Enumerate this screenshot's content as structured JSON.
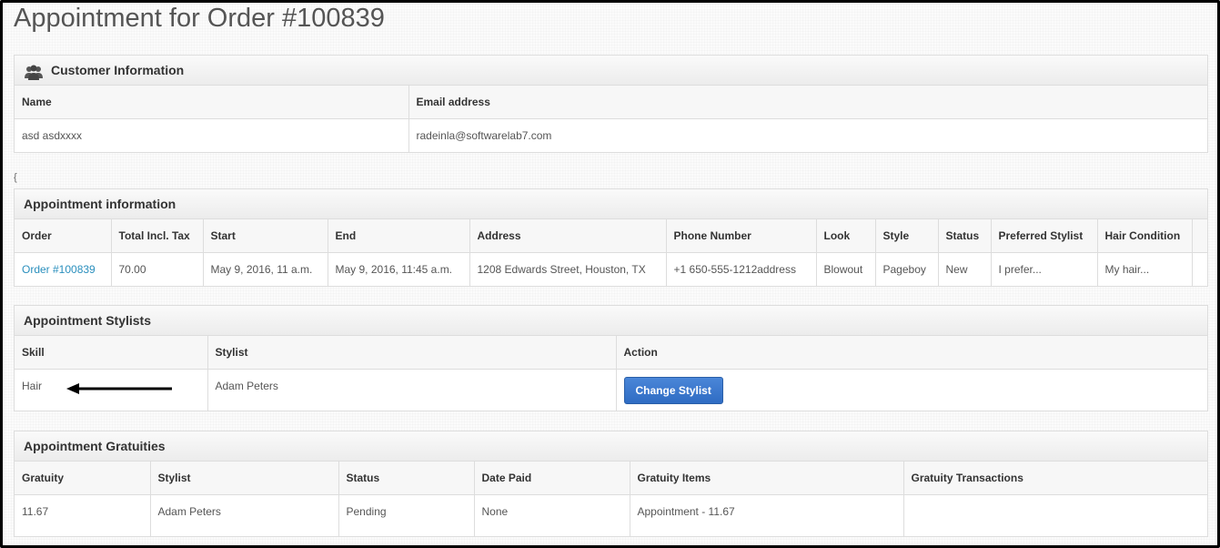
{
  "page": {
    "title": "Appointment for Order #100839",
    "stray_char": "{"
  },
  "customer": {
    "heading": "Customer Information",
    "icon": "users-icon",
    "columns": [
      "Name",
      "Email address"
    ],
    "row": [
      "asd asdxxxx",
      "radeinla@softwarelab7.com"
    ]
  },
  "appointment": {
    "heading": "Appointment information",
    "columns": [
      "Order",
      "Total Incl. Tax",
      "Start",
      "End",
      "Address",
      "Phone Number",
      "Look",
      "Style",
      "Status",
      "Preferred Stylist",
      "Hair Condition",
      ""
    ],
    "row": {
      "order": "Order #100839",
      "total": "70.00",
      "start": "May 9, 2016, 11 a.m.",
      "end": "May 9, 2016, 11:45 a.m.",
      "address": "1208 Edwards Street, Houston, TX",
      "phone": "+1 650-555-1212address",
      "look": "Blowout",
      "style": "Pageboy",
      "status": "New",
      "preferred_stylist": "I prefer...",
      "hair_condition": "My hair..."
    }
  },
  "stylists": {
    "heading": "Appointment Stylists",
    "columns": [
      "Skill",
      "Stylist",
      "Action"
    ],
    "row": {
      "skill": "Hair",
      "stylist": "Adam Peters",
      "action_label": "Change Stylist"
    }
  },
  "gratuities": {
    "heading": "Appointment Gratuities",
    "columns": [
      "Gratuity",
      "Stylist",
      "Status",
      "Date Paid",
      "Gratuity Items",
      "Gratuity Transactions"
    ],
    "row": [
      "11.67",
      "Adam Peters",
      "Pending",
      "None",
      "Appointment - 11.67",
      ""
    ]
  },
  "colors": {
    "link": "#2a8fbd",
    "button": "#3a78cf",
    "panel_head": "#efefef",
    "border": "#dddddd"
  }
}
